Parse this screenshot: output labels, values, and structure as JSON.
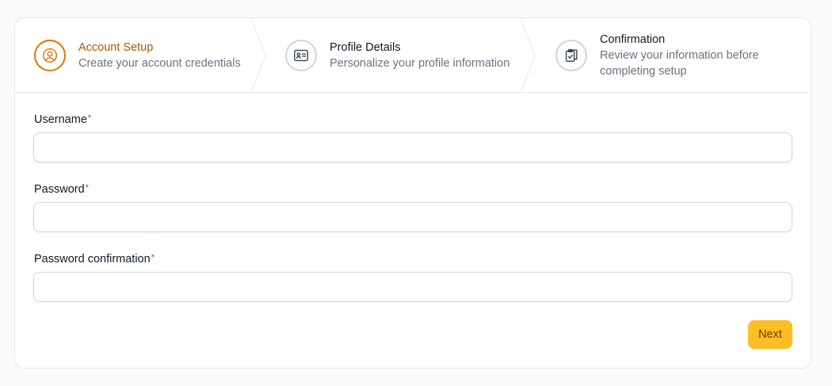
{
  "steps": [
    {
      "title": "Account Setup",
      "description": "Create your account credentials",
      "icon": "user-circle-icon",
      "active": true
    },
    {
      "title": "Profile Details",
      "description": "Personalize your profile information",
      "icon": "id-card-icon",
      "active": false
    },
    {
      "title": "Confirmation",
      "description": "Review your information before completing setup",
      "icon": "clipboard-check-icon",
      "active": false
    }
  ],
  "form": {
    "fields": [
      {
        "label": "Username",
        "required_mark": "*",
        "value": "",
        "placeholder": ""
      },
      {
        "label": "Password",
        "required_mark": "*",
        "value": "",
        "placeholder": ""
      },
      {
        "label": "Password confirmation",
        "required_mark": "*",
        "value": "",
        "placeholder": ""
      }
    ],
    "next_label": "Next"
  },
  "colors": {
    "accent": "#d97706",
    "accent_text": "#b45309",
    "button_bg": "#fbbf24",
    "required": "#dc2626"
  }
}
